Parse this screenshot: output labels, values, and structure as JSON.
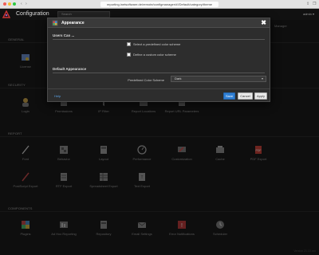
{
  "browser": {
    "url": "reporting.inetsoftware.de/remote/configmanager/#!/Default/category/theme"
  },
  "app": {
    "title": "Configuration",
    "search_placeholder": "Search",
    "user": "admin ▾"
  },
  "sections": {
    "general": "GENERAL",
    "security": "SECURITY",
    "report": "REPORT",
    "components": "COMPONENTS"
  },
  "tiles": {
    "general": [
      "License"
    ],
    "security": [
      "Login",
      "Permissions",
      "IP Filter",
      "Report Locations",
      "Report URL Parameters"
    ],
    "report_row1": [
      "Font",
      "Behavior",
      "Layout",
      "Performance",
      "Customization",
      "Cache",
      "PDF Export"
    ],
    "report_row2": [
      "PostScript Export",
      "RTF Export",
      "Spreadsheet Export",
      "Text Export"
    ],
    "components": [
      "Plugins",
      "Ad Hoc Reporting",
      "Repository",
      "Email Settings",
      "Error Notifications",
      "Scheduler"
    ]
  },
  "dialog": {
    "title": "Appearance",
    "users_can_heading": "Users Can ...",
    "option_predefined": "Select a predefined color scheme",
    "option_custom": "Define a custom color scheme",
    "default_heading": "Default Appearance",
    "scheme_label": "Predefined Color Scheme",
    "scheme_value": "Dark",
    "help": "Help",
    "save": "Save",
    "cancel": "Cancel",
    "apply": "Apply",
    "close": "✖"
  },
  "background_header_buttons": [
    "Manager"
  ],
  "version": "Version 21.10.xxx"
}
